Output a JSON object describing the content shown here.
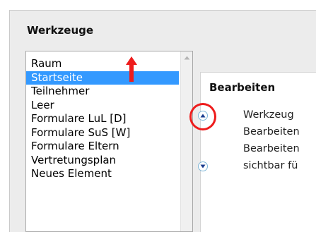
{
  "panel": {
    "title": "Werkzeuge"
  },
  "tool_list": {
    "items": [
      {
        "label": "Raum"
      },
      {
        "label": "Startseite",
        "selected": true
      },
      {
        "label": "Teilnehmer"
      },
      {
        "label": "Leer"
      },
      {
        "label": "Formulare LuL  [D]"
      },
      {
        "label": "Formulare SuS  [W]"
      },
      {
        "label": "Formulare Eltern"
      },
      {
        "label": "Vertretungsplan"
      },
      {
        "label": "Neues Element"
      }
    ]
  },
  "edit_section": {
    "title": "Bearbeiten",
    "rows": [
      {
        "text": "Werkzeug"
      },
      {
        "text": "Bearbeiten"
      },
      {
        "text": "Bearbeiten"
      },
      {
        "text": "sichtbar fü"
      }
    ]
  },
  "icons": {
    "move_up": "arrow-up-icon",
    "move_down": "arrow-down-icon",
    "scroll_up": "triangle-up-icon"
  },
  "colors": {
    "selection": "#3399ff",
    "annotation": "#ee1c1c",
    "button_icon": "#1a3d8f",
    "button_border": "#7fb7d8"
  }
}
